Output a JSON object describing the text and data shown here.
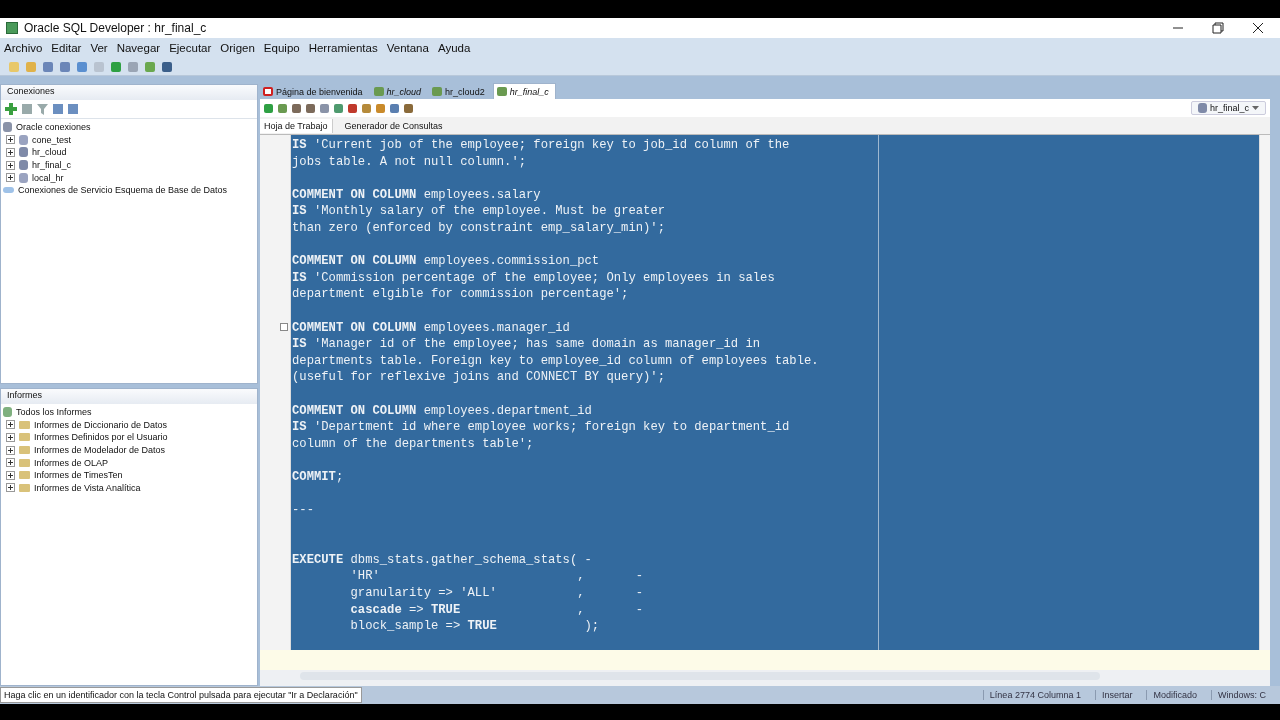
{
  "window": {
    "title": "Oracle SQL Developer : hr_final_c"
  },
  "menu": [
    "Archivo",
    "Editar",
    "Ver",
    "Navegar",
    "Ejecutar",
    "Origen",
    "Equipo",
    "Herramientas",
    "Ventana",
    "Ayuda"
  ],
  "connections_panel": {
    "title": "Conexiones",
    "tree": [
      {
        "label": "Oracle conexiones",
        "kind": "root",
        "children": [
          {
            "label": "cone_test",
            "kind": "db",
            "expanded": false
          },
          {
            "label": "hr_cloud",
            "kind": "dbsearch",
            "expanded": false
          },
          {
            "label": "hr_final_c",
            "kind": "dbsearch",
            "expanded": false
          },
          {
            "label": "local_hr",
            "kind": "db",
            "expanded": false
          }
        ]
      },
      {
        "label": "Conexiones de Servicio Esquema de Base de Datos",
        "kind": "cloud"
      }
    ]
  },
  "reports_panel": {
    "title": "Informes",
    "tree": [
      {
        "label": "Todos los Informes",
        "kind": "root",
        "children": [
          {
            "label": "Informes de Diccionario de Datos",
            "kind": "folder",
            "expanded": false
          },
          {
            "label": "Informes Definidos por el Usuario",
            "kind": "folder",
            "expanded": false
          },
          {
            "label": "Informes de Modelador de Datos",
            "kind": "folder",
            "expanded": false
          },
          {
            "label": "Informes de OLAP",
            "kind": "folder",
            "expanded": false
          },
          {
            "label": "Informes de TimesTen",
            "kind": "folder",
            "expanded": false
          },
          {
            "label": "Informes de Vista Analítica",
            "kind": "folder",
            "expanded": false
          }
        ]
      }
    ]
  },
  "editor_tabs": [
    {
      "label": "Página de bienvenida",
      "kind": "welcome",
      "italic": false,
      "selected": false
    },
    {
      "label": "hr_cloud",
      "kind": "conn",
      "italic": true,
      "selected": false
    },
    {
      "label": "hr_cloud2",
      "kind": "conn",
      "italic": false,
      "selected": false
    },
    {
      "label": "hr_final_c",
      "kind": "conn",
      "italic": true,
      "selected": true
    }
  ],
  "connection_selector": "hr_final_c",
  "sub_tabs": [
    {
      "label": "Hoja de Trabajo",
      "selected": true
    },
    {
      "label": "Generador de Consultas",
      "selected": false
    }
  ],
  "code_lines": [
    {
      "kind": "code",
      "text": "**IS** 'Current job of the employee; foreign key to job_id column of the"
    },
    {
      "kind": "code",
      "text": "jobs table. A not null column.';"
    },
    {
      "kind": "blank"
    },
    {
      "kind": "code",
      "text": "**COMMENT ON COLUMN** employees.salary"
    },
    {
      "kind": "code",
      "text": "**IS** 'Monthly salary of the employee. Must be greater"
    },
    {
      "kind": "code",
      "text": "than zero (enforced by constraint emp_salary_min)';"
    },
    {
      "kind": "blank"
    },
    {
      "kind": "code",
      "text": "**COMMENT ON COLUMN** employees.commission_pct"
    },
    {
      "kind": "code",
      "text": "**IS** 'Commission percentage of the employee; Only employees in sales"
    },
    {
      "kind": "code",
      "text": "department elgible for commission percentage';"
    },
    {
      "kind": "blank"
    },
    {
      "kind": "code",
      "text": "**COMMENT ON COLUMN** employees.manager_id",
      "fold": true
    },
    {
      "kind": "code",
      "text": "**IS** 'Manager id of the employee; has same domain as manager_id in"
    },
    {
      "kind": "code",
      "text": "departments table. Foreign key to employee_id column of employees table."
    },
    {
      "kind": "code",
      "text": "(useful for reflexive joins and CONNECT BY query)';"
    },
    {
      "kind": "blank"
    },
    {
      "kind": "code",
      "text": "**COMMENT ON COLUMN** employees.department_id"
    },
    {
      "kind": "code",
      "text": "**IS** 'Department id where employee works; foreign key to department_id"
    },
    {
      "kind": "code",
      "text": "column of the departments table';"
    },
    {
      "kind": "blank"
    },
    {
      "kind": "code",
      "text": "**COMMIT**;"
    },
    {
      "kind": "blank"
    },
    {
      "kind": "code",
      "text": "---"
    },
    {
      "kind": "blank"
    },
    {
      "kind": "blank"
    },
    {
      "kind": "code",
      "text": "**EXECUTE** dbms_stats.gather_schema_stats( -"
    },
    {
      "kind": "code",
      "text": "        'HR'                           ,       -"
    },
    {
      "kind": "code",
      "text": "        granularity => 'ALL'           ,       -"
    },
    {
      "kind": "code",
      "text": "        **cascade** => **TRUE**                ,       -"
    },
    {
      "kind": "code",
      "text": "        block_sample => **TRUE**            );"
    }
  ],
  "status_bar": {
    "message": "Haga clic en un identificador con la tecla Control pulsada para ejecutar \"Ir a Declaración\"",
    "items": [
      "Línea 2774 Columna 1",
      "Insertar",
      "Modificado",
      "Windows: C"
    ]
  }
}
